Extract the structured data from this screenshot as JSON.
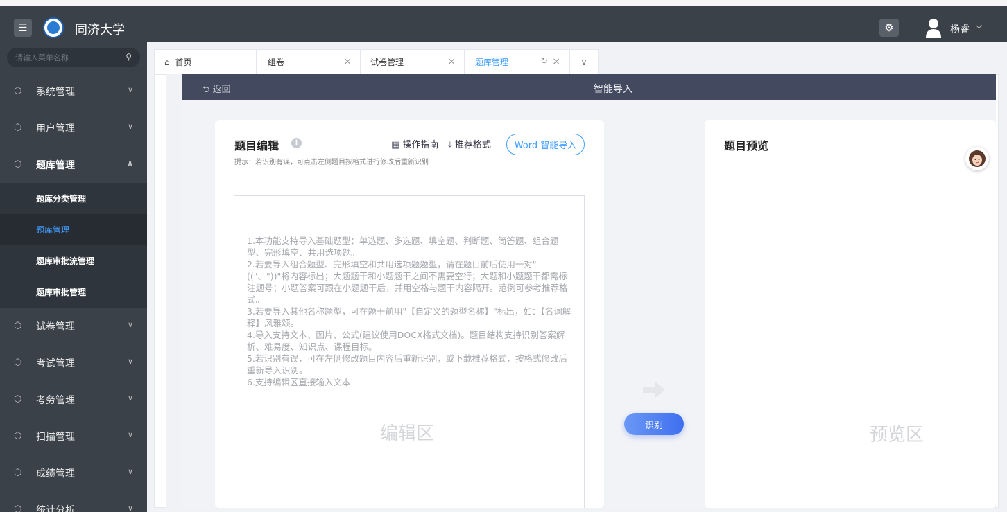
{
  "topbar": {
    "brand": "同济大学",
    "user_name": "杨睿",
    "menu_icon": "menu-icon",
    "settings_icon": "gear-icon"
  },
  "sidebar": {
    "search_placeholder": "请输入菜单名称",
    "items_top": [
      {
        "label": "系统管理"
      },
      {
        "label": "用户管理"
      },
      {
        "label": "题库管理"
      }
    ],
    "sub_items": [
      {
        "label": "题库分类管理"
      },
      {
        "label": "题库管理"
      },
      {
        "label": "题库审批流管理"
      },
      {
        "label": "题库审批管理"
      }
    ],
    "items_bottom": [
      {
        "label": "试卷管理"
      },
      {
        "label": "考试管理"
      },
      {
        "label": "考务管理"
      },
      {
        "label": "扫描管理"
      },
      {
        "label": "成绩管理"
      },
      {
        "label": "统计分析"
      }
    ]
  },
  "tabs": [
    {
      "label": "首页"
    },
    {
      "label": "组卷"
    },
    {
      "label": "试卷管理"
    },
    {
      "label": "题库管理"
    }
  ],
  "header": {
    "back_label": "返回",
    "title": "智能导入"
  },
  "editor": {
    "title": "题目编辑",
    "guide_label": "操作指南",
    "format_label": "推荐格式",
    "word_import_label": "Word 智能导入",
    "hint": "提示：若识别有误，可点击左侧题目按格式进行修改后重新识别",
    "instructions": [
      "1.本功能支持导入基础题型：单选题、多选题、填空题、判断题、简答题、组合题型、完形填空、共用选项题。",
      "2.若要导入组合题型、完形填空和共用选项题题型，请在题目前后使用一对\"((\"、\"))\"将内容标出；大题题干和小题题干之间不需要空行；大题和小题题干都需标注题号；小题答案可跟在小题题干后，并用空格与题干内容隔开。范例可参考推荐格式。",
      "3.若要导入其他名称题型，可在题干前用\"【自定义的题型名称】\"标出，如：【名词解释】风雅颂。",
      "4.导入支持文本、图片、公式(建议使用DOCX格式文档)。题目结构支持识别答案解析、难易度、知识点、课程目标。",
      "5.若识别有误，可在左侧修改题目内容后重新识别，或下载推荐格式，按格式修改后重新导入识别。",
      "6.支持编辑区直接输入文本"
    ],
    "area_label": "编辑区"
  },
  "recognize_label": "识别",
  "preview": {
    "title": "题目预览",
    "area_label": "预览区"
  },
  "colors": {
    "sidebar_bg": "#3a4149",
    "accent": "#409eff",
    "header_bar": "#434a5f"
  }
}
